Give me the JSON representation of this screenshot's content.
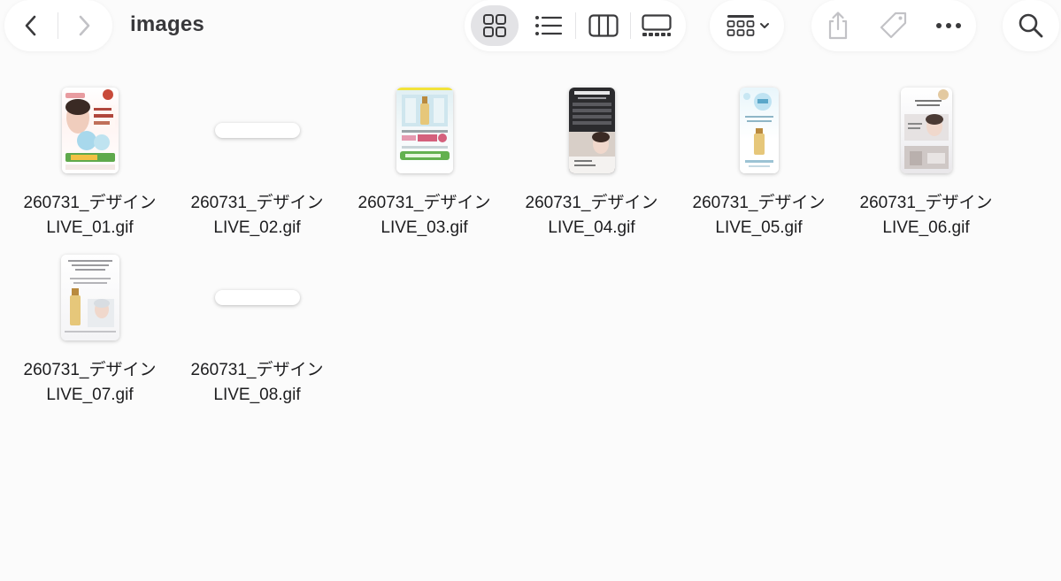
{
  "window": {
    "title": "images"
  },
  "toolbar": {
    "nav": {
      "back": "chevron-left-icon",
      "forward": "chevron-right-icon"
    },
    "views": [
      "icon-view-icon",
      "list-view-icon",
      "column-view-icon",
      "gallery-view-icon"
    ],
    "group": "group-by-icon",
    "actions": [
      "share-icon",
      "tag-icon",
      "more-icon"
    ],
    "search": "search-icon"
  },
  "files": [
    {
      "line1": "260731_デザイン",
      "line2": "LIVE_01.gif"
    },
    {
      "line1": "260731_デザイン",
      "line2": "LIVE_02.gif"
    },
    {
      "line1": "260731_デザイン",
      "line2": "LIVE_03.gif"
    },
    {
      "line1": "260731_デザイン",
      "line2": "LIVE_04.gif"
    },
    {
      "line1": "260731_デザイン",
      "line2": "LIVE_05.gif"
    },
    {
      "line1": "260731_デザイン",
      "line2": "LIVE_06.gif"
    },
    {
      "line1": "260731_デザイン",
      "line2": "LIVE_07.gif"
    },
    {
      "line1": "260731_デザイン",
      "line2": "LIVE_08.gif"
    }
  ],
  "colors": {
    "background": "#fbfbfb",
    "toolbar": "#ffffff",
    "selected_view": "#e3e3e6",
    "icon": "#3a3a3c"
  }
}
